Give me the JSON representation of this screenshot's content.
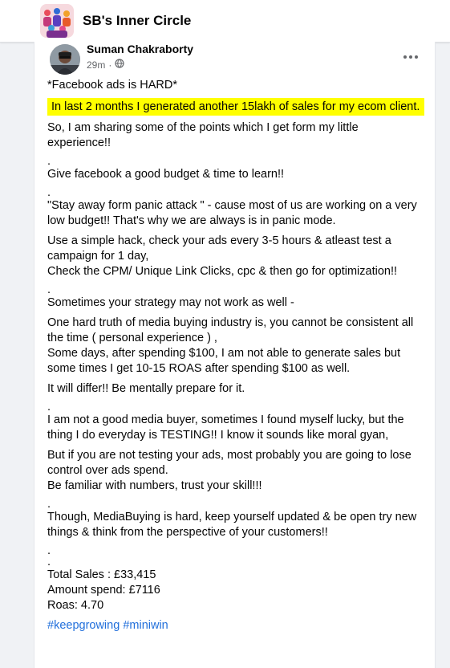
{
  "header": {
    "group_name": "SB's Inner Circle"
  },
  "post": {
    "author": "Suman Chakraborty",
    "time": "29m",
    "privacy_icon": "globe-icon",
    "title": "*Facebook ads is HARD*",
    "highlight": "In last 2 months I generated another 15lakh of sales for my ecom client.",
    "p1": "So, I am sharing some of the points which I get form my little experience!!",
    "p2": "Give facebook a good budget & time to learn!!",
    "p3": "\"Stay away form panic attack \" - cause most of us are working on a very low budget!! That's why we are always is in panic mode.",
    "p4a": "Use a simple hack, check your ads every 3-5 hours & atleast test a campaign for 1 day,",
    "p4b": "Check the CPM/ Unique Link Clicks, cpc & then go for optimization!!",
    "p5": "Sometimes your strategy may not work as well -",
    "p6a": "One hard truth of media buying industry is, you cannot be consistent all the time ( personal experience ) ,",
    "p6b": "Some days, after spending $100, I am not able to generate sales but some times I get 10-15 ROAS after spending $100 as well.",
    "p7": "It will differ!! Be mentally prepare for it.",
    "p8": "I am not a good media buyer, sometimes I found myself lucky, but the thing I do everyday is TESTING!! I know it sounds like moral gyan,",
    "p9a": "But if you are not testing your ads, most probably you are going to lose control over ads spend.",
    "p9b": "Be familiar with numbers,  trust your skill!!!",
    "p10": "Though, MediaBuying is hard, keep yourself updated & be open try new things & think from the perspective of your customers!!",
    "dot": ".",
    "stats": {
      "total_sales": "Total Sales : £33,415",
      "amount_spend": "Amount spend: £7116",
      "roas": "Roas: 4.70"
    },
    "hashtags": [
      "#keepgrowing",
      "#miniwin"
    ]
  },
  "colors": {
    "highlight": "#ffff00",
    "hashtag": "#216fdb",
    "meta": "#65676b"
  }
}
